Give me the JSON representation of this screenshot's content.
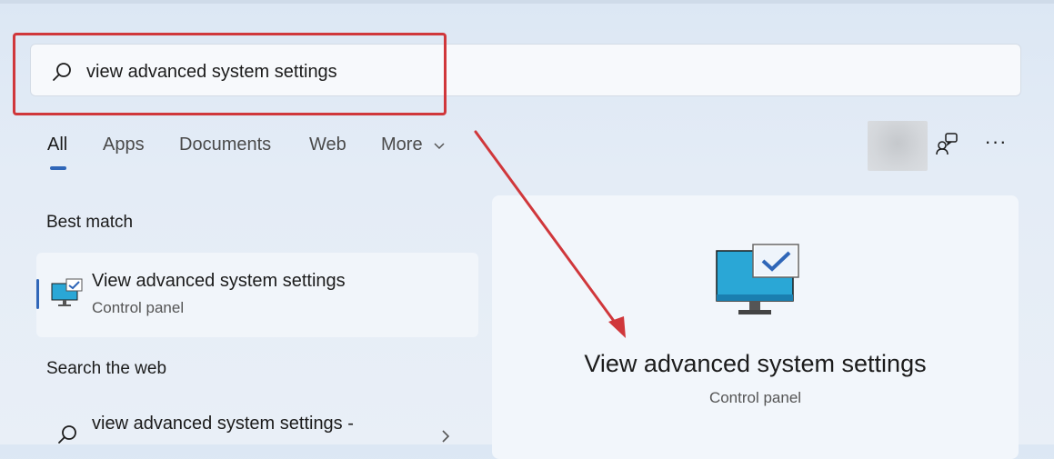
{
  "search": {
    "value": "view advanced system settings",
    "icon": "search-icon"
  },
  "tabs": [
    {
      "label": "All",
      "active": true
    },
    {
      "label": "Apps"
    },
    {
      "label": "Documents"
    },
    {
      "label": "Web"
    },
    {
      "label": "More"
    }
  ],
  "header_icons": [
    "avatar",
    "feedback-icon",
    "more-options-icon"
  ],
  "best_match": {
    "section_title": "Best match",
    "title": "View advanced system settings",
    "subtitle": "Control panel",
    "icon": "monitor-check-icon"
  },
  "search_web": {
    "section_title": "Search the web",
    "text": "view advanced system settings -",
    "icon": "search-icon"
  },
  "detail": {
    "title": "View advanced system settings",
    "subtitle": "Control panel",
    "icon": "monitor-check-icon"
  },
  "colors": {
    "accent": "#2f66b8",
    "annotation": "#d0373b",
    "background": "#e4ecf6"
  }
}
